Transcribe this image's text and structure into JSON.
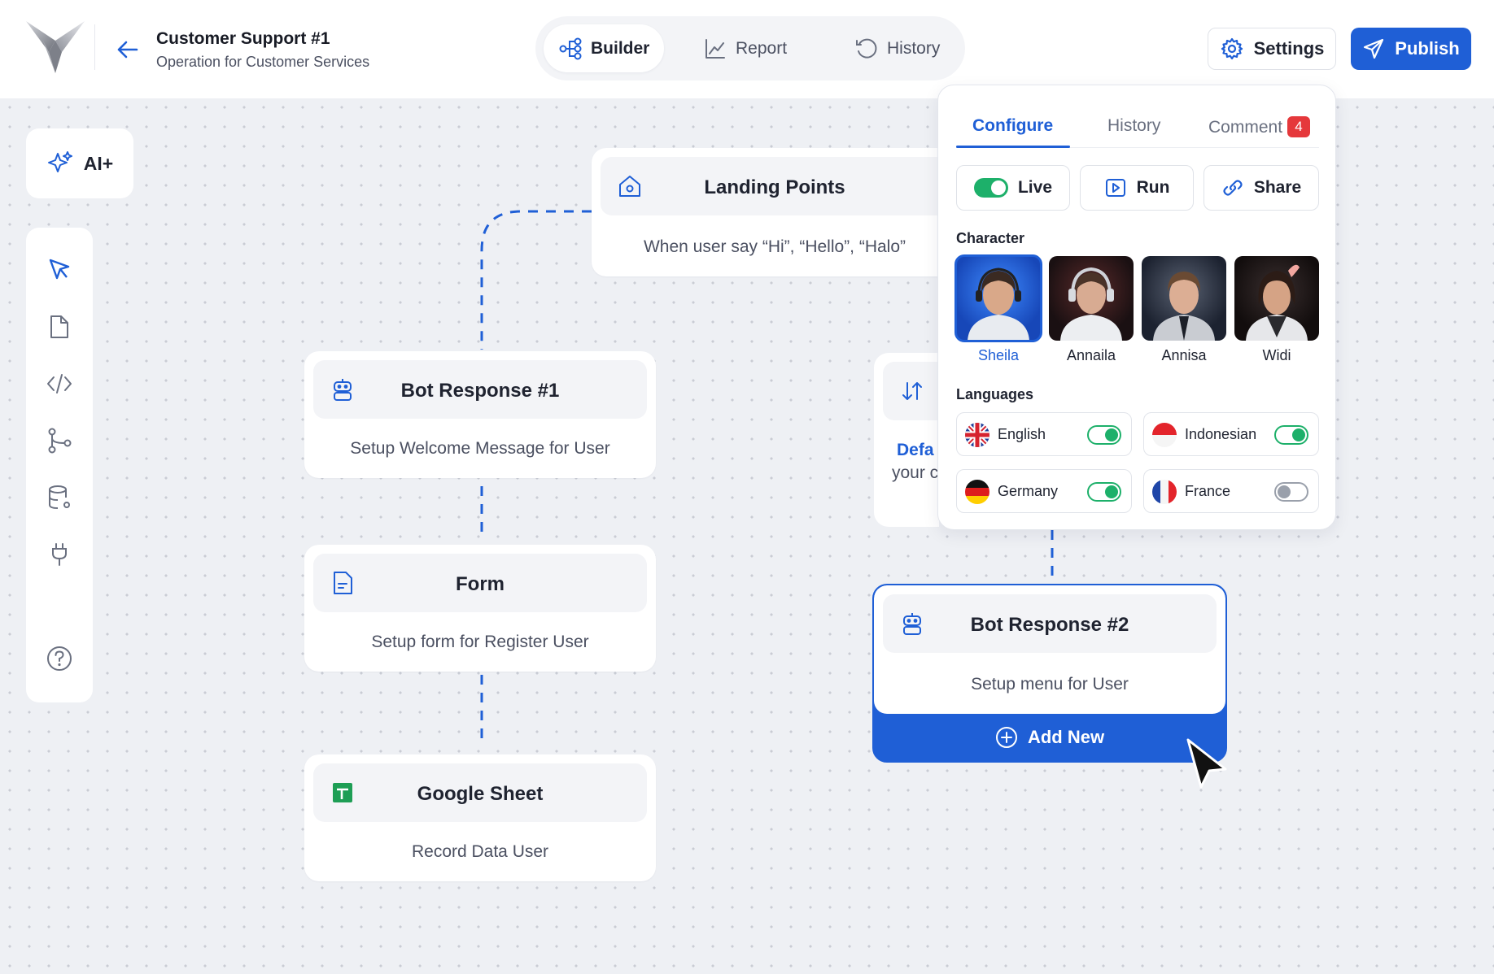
{
  "header": {
    "title": "Customer Support #1",
    "subtitle": "Operation for Customer Services",
    "nav": [
      {
        "label": "Builder",
        "icon": "flow-icon",
        "active": true
      },
      {
        "label": "Report",
        "icon": "chart-line-icon",
        "active": false
      },
      {
        "label": "History",
        "icon": "history-icon",
        "active": false
      }
    ],
    "settings_label": "Settings",
    "publish_label": "Publish"
  },
  "toolbar": {
    "ai_label": "AI+",
    "tools": [
      "cursor-icon",
      "file-icon",
      "code-icon",
      "branch-icon",
      "database-icon",
      "plug-icon",
      "help-icon"
    ]
  },
  "nodes": {
    "landing": {
      "title": "Landing Points",
      "desc": "When user say “Hi”,  “Hello”, “Halo”"
    },
    "bot1": {
      "title": "Bot Response #1",
      "desc": "Setup Welcome Message for User"
    },
    "form": {
      "title": "Form",
      "desc": "Setup form for Register User"
    },
    "sheet": {
      "title": "Google Sheet",
      "desc": "Record Data User"
    },
    "partial": {
      "link": "Defa",
      "text": "your c"
    },
    "bot2": {
      "title": "Bot Response #2",
      "desc": "Setup menu for User",
      "add_label": "Add New"
    }
  },
  "popover": {
    "tabs": [
      {
        "label": "Configure",
        "active": true
      },
      {
        "label": "History",
        "active": false
      },
      {
        "label": "Comment",
        "badge": "4",
        "active": false
      }
    ],
    "actions": {
      "live": "Live",
      "run": "Run",
      "share": "Share"
    },
    "character_label": "Character",
    "characters": [
      {
        "name": "Sheila",
        "selected": true
      },
      {
        "name": "Annaila",
        "selected": false
      },
      {
        "name": "Annisa",
        "selected": false
      },
      {
        "name": "Widi",
        "selected": false
      }
    ],
    "languages_label": "Languages",
    "languages": [
      {
        "name": "English",
        "enabled": true
      },
      {
        "name": "Indonesian",
        "enabled": true
      },
      {
        "name": "Germany",
        "enabled": true
      },
      {
        "name": "France",
        "enabled": false
      }
    ]
  },
  "colors": {
    "accent": "#1f5fd6",
    "toggle_on": "#1db06a",
    "badge": "#e5383b"
  }
}
